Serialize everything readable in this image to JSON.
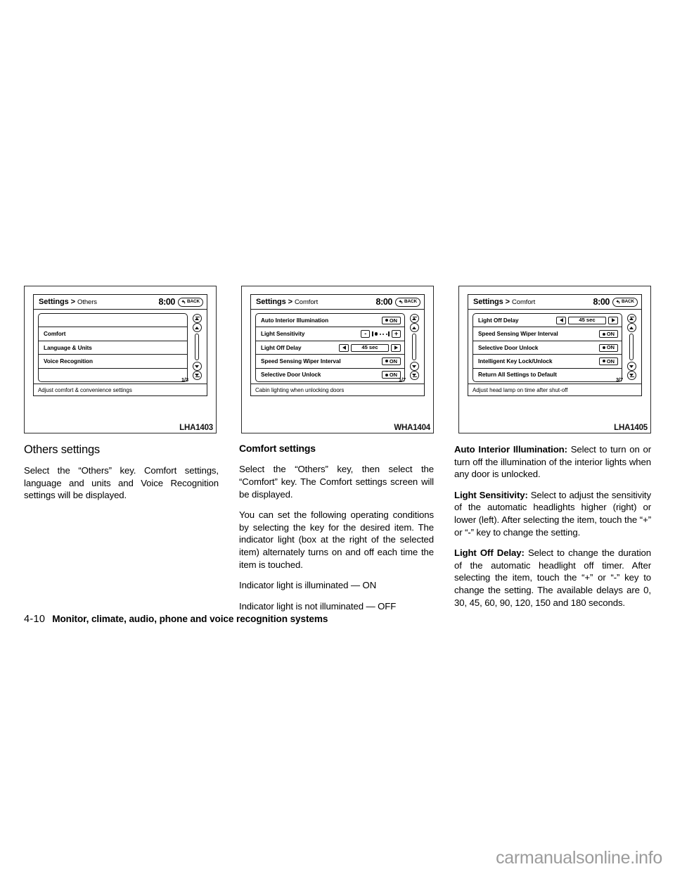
{
  "figures": [
    {
      "code": "LHA1403",
      "header": {
        "title": "Settings",
        "separator": ">",
        "subtitle": "Others",
        "clock": "8:00",
        "back_label": "BACK"
      },
      "rows": [
        {
          "type": "blank",
          "label": ""
        },
        {
          "type": "plain",
          "label": "Comfort"
        },
        {
          "type": "plain",
          "label": "Language & Units"
        },
        {
          "type": "plain",
          "label": "Voice Recognition"
        },
        {
          "type": "blank",
          "label": ""
        }
      ],
      "pager": "1/3",
      "status": "Adjust comfort & convenience settings"
    },
    {
      "code": "WHA1404",
      "header": {
        "title": "Settings",
        "separator": ">",
        "subtitle": "Comfort",
        "clock": "8:00",
        "back_label": "BACK"
      },
      "rows": [
        {
          "type": "toggle",
          "label": "Auto Interior Illumination",
          "value": "ON"
        },
        {
          "type": "sensitivity",
          "label": "Light Sensitivity",
          "minus": "-",
          "plus": "+",
          "level": 1,
          "steps": 4
        },
        {
          "type": "stepper",
          "label": "Light Off Delay",
          "value": "45 sec"
        },
        {
          "type": "toggle",
          "label": "Speed Sensing Wiper Interval",
          "value": "ON"
        },
        {
          "type": "toggle",
          "label": "Selective Door Unlock",
          "value": "ON"
        }
      ],
      "pager": "1/7",
      "status": "Cabin lighting when unlocking doors"
    },
    {
      "code": "LHA1405",
      "header": {
        "title": "Settings",
        "separator": ">",
        "subtitle": "Comfort",
        "clock": "8:00",
        "back_label": "BACK"
      },
      "rows": [
        {
          "type": "stepper",
          "label": "Light Off Delay",
          "value": "45 sec"
        },
        {
          "type": "toggle",
          "label": "Speed Sensing Wiper Interval",
          "value": "ON"
        },
        {
          "type": "toggle",
          "label": "Selective Door Unlock",
          "value": "ON"
        },
        {
          "type": "toggle",
          "label": "Intelligent Key Lock/Unlock",
          "value": "ON"
        },
        {
          "type": "plain",
          "label": "Return All Settings to Default"
        }
      ],
      "pager": "3/7",
      "status": "Adjust head lamp on time after shut-off"
    }
  ],
  "columns": {
    "left": {
      "heading": "Others settings",
      "paragraphs": [
        "Select the “Others” key. Comfort settings, language and units and Voice Recognition settings will be displayed."
      ]
    },
    "middle": {
      "heading": "Comfort settings",
      "paragraphs": [
        "Select the “Others” key, then select the “Comfort” key. The Comfort settings screen will be displayed.",
        "You can set the following operating conditions by selecting the key for the desired item. The indicator light (box at the right of the selected item) alternately turns on and off each time the item is touched.",
        "Indicator light is illuminated — ON",
        "Indicator light is not illuminated — OFF"
      ]
    },
    "right": {
      "entries": [
        {
          "term": "Auto Interior Illumination:",
          "text": " Select to turn on or turn off the illumination of the interior lights when any door is unlocked."
        },
        {
          "term": "Light Sensitivity:",
          "text": " Select to adjust the sensitivity of the automatic headlights higher (right) or lower (left). After selecting the item, touch the “+” or “-” key to change the setting."
        },
        {
          "term": "Light Off Delay:",
          "text": " Select to change the duration of the automatic headlight off timer. After selecting the item, touch the “+” or “-” key to change the setting. The available delays are 0, 30, 45, 60, 90, 120, 150 and 180 seconds."
        }
      ]
    }
  },
  "footer": {
    "page": "4-10",
    "title": "Monitor, climate, audio, phone and voice recognition systems"
  },
  "watermark": "carmanualsonline.info"
}
